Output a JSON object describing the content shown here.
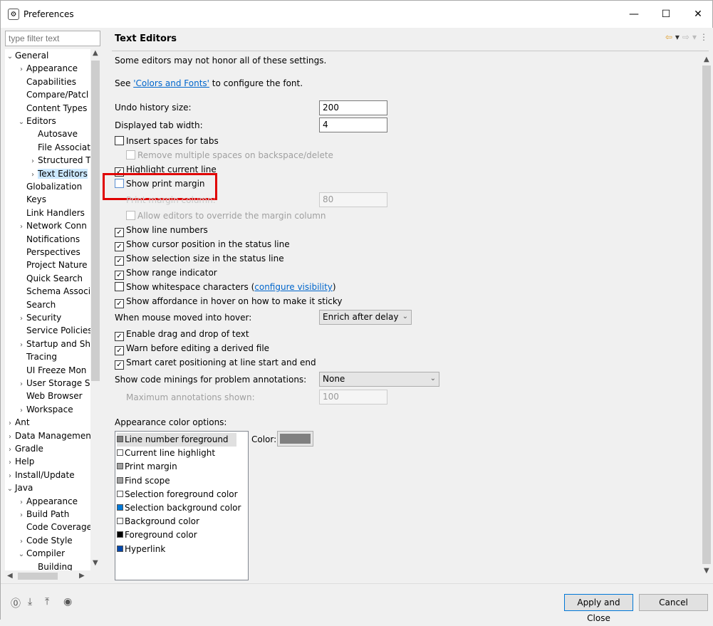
{
  "window": {
    "title": "Preferences"
  },
  "filter": {
    "placeholder": "type filter text"
  },
  "tree": [
    {
      "label": "General",
      "level": 0,
      "tw": "v"
    },
    {
      "label": "Appearance",
      "level": 1,
      "tw": ">"
    },
    {
      "label": "Capabilities",
      "level": 1,
      "tw": ""
    },
    {
      "label": "Compare/Patcl",
      "level": 1,
      "tw": ""
    },
    {
      "label": "Content Types",
      "level": 1,
      "tw": ""
    },
    {
      "label": "Editors",
      "level": 1,
      "tw": "v"
    },
    {
      "label": "Autosave",
      "level": 2,
      "tw": ""
    },
    {
      "label": "File Associat",
      "level": 2,
      "tw": ""
    },
    {
      "label": "Structured T",
      "level": 2,
      "tw": ">"
    },
    {
      "label": "Text Editors",
      "level": 2,
      "tw": ">",
      "selected": true
    },
    {
      "label": "Globalization",
      "level": 1,
      "tw": ""
    },
    {
      "label": "Keys",
      "level": 1,
      "tw": ""
    },
    {
      "label": "Link Handlers",
      "level": 1,
      "tw": ""
    },
    {
      "label": "Network Conn",
      "level": 1,
      "tw": ">"
    },
    {
      "label": "Notifications",
      "level": 1,
      "tw": ""
    },
    {
      "label": "Perspectives",
      "level": 1,
      "tw": ""
    },
    {
      "label": "Project Nature",
      "level": 1,
      "tw": ""
    },
    {
      "label": "Quick Search",
      "level": 1,
      "tw": ""
    },
    {
      "label": "Schema Associ",
      "level": 1,
      "tw": ""
    },
    {
      "label": "Search",
      "level": 1,
      "tw": ""
    },
    {
      "label": "Security",
      "level": 1,
      "tw": ">"
    },
    {
      "label": "Service Policies",
      "level": 1,
      "tw": ""
    },
    {
      "label": "Startup and Sh",
      "level": 1,
      "tw": ">"
    },
    {
      "label": "Tracing",
      "level": 1,
      "tw": ""
    },
    {
      "label": "UI Freeze Mon",
      "level": 1,
      "tw": ""
    },
    {
      "label": "User Storage S",
      "level": 1,
      "tw": ">"
    },
    {
      "label": "Web Browser",
      "level": 1,
      "tw": ""
    },
    {
      "label": "Workspace",
      "level": 1,
      "tw": ">"
    },
    {
      "label": "Ant",
      "level": 0,
      "tw": ">"
    },
    {
      "label": "Data Managemen",
      "level": 0,
      "tw": ">"
    },
    {
      "label": "Gradle",
      "level": 0,
      "tw": ">"
    },
    {
      "label": "Help",
      "level": 0,
      "tw": ">"
    },
    {
      "label": "Install/Update",
      "level": 0,
      "tw": ">"
    },
    {
      "label": "Java",
      "level": 0,
      "tw": "v"
    },
    {
      "label": "Appearance",
      "level": 1,
      "tw": ">"
    },
    {
      "label": "Build Path",
      "level": 1,
      "tw": ">"
    },
    {
      "label": "Code Coverage",
      "level": 1,
      "tw": ""
    },
    {
      "label": "Code Style",
      "level": 1,
      "tw": ">"
    },
    {
      "label": "Compiler",
      "level": 1,
      "tw": "v"
    },
    {
      "label": "Building",
      "level": 2,
      "tw": ""
    }
  ],
  "page": {
    "title": "Text Editors",
    "note": "Some editors may not honor all of these settings.",
    "see_prefix": "See ",
    "see_link": "'Colors and Fonts'",
    "see_suffix": " to configure the font.",
    "undo_label": "Undo history size:",
    "undo_value": "200",
    "tab_label": "Displayed tab width:",
    "tab_value": "4",
    "insert_spaces": "Insert spaces for tabs",
    "remove_spaces": "Remove multiple spaces on backspace/delete",
    "highlight_line": "Highlight current line",
    "show_print_margin": "Show print margin",
    "print_margin_col_label": "Print margin column:",
    "print_margin_col_value": "80",
    "allow_override": "Allow editors to override the margin column",
    "line_numbers": "Show line numbers",
    "cursor_pos": "Show cursor position in the status line",
    "selection_size": "Show selection size in the status line",
    "range_indicator": "Show range indicator",
    "whitespace_prefix": "Show whitespace characters (",
    "whitespace_link": "configure visibility",
    "whitespace_suffix": ")",
    "affordance": "Show affordance in hover on how to make it sticky",
    "hover_label": "When mouse moved into hover:",
    "hover_value": "Enrich after delay",
    "drag_drop": "Enable drag and drop of text",
    "warn_derived": "Warn before editing a derived file",
    "smart_caret": "Smart caret positioning at line start and end",
    "minings_label": "Show code minings for problem annotations:",
    "minings_value": "None",
    "max_annot_label": "Maximum annotations shown:",
    "max_annot_value": "100",
    "appearance_label": "Appearance color options:",
    "color_label": "Color:"
  },
  "color_options": [
    {
      "label": "Line number foreground",
      "color": "#808080",
      "selected": true
    },
    {
      "label": "Current line highlight",
      "color": "#ffffff"
    },
    {
      "label": "Print margin",
      "color": "#a0a0a0"
    },
    {
      "label": "Find scope",
      "color": "#a0a0a0"
    },
    {
      "label": "Selection foreground color",
      "color": "#ffffff"
    },
    {
      "label": "Selection background color",
      "color": "#0078d7"
    },
    {
      "label": "Background color",
      "color": "#ffffff"
    },
    {
      "label": "Foreground color",
      "color": "#000000"
    },
    {
      "label": "Hyperlink",
      "color": "#0047ab"
    }
  ],
  "buttons": {
    "apply_close": "Apply and Close",
    "cancel": "Cancel"
  }
}
